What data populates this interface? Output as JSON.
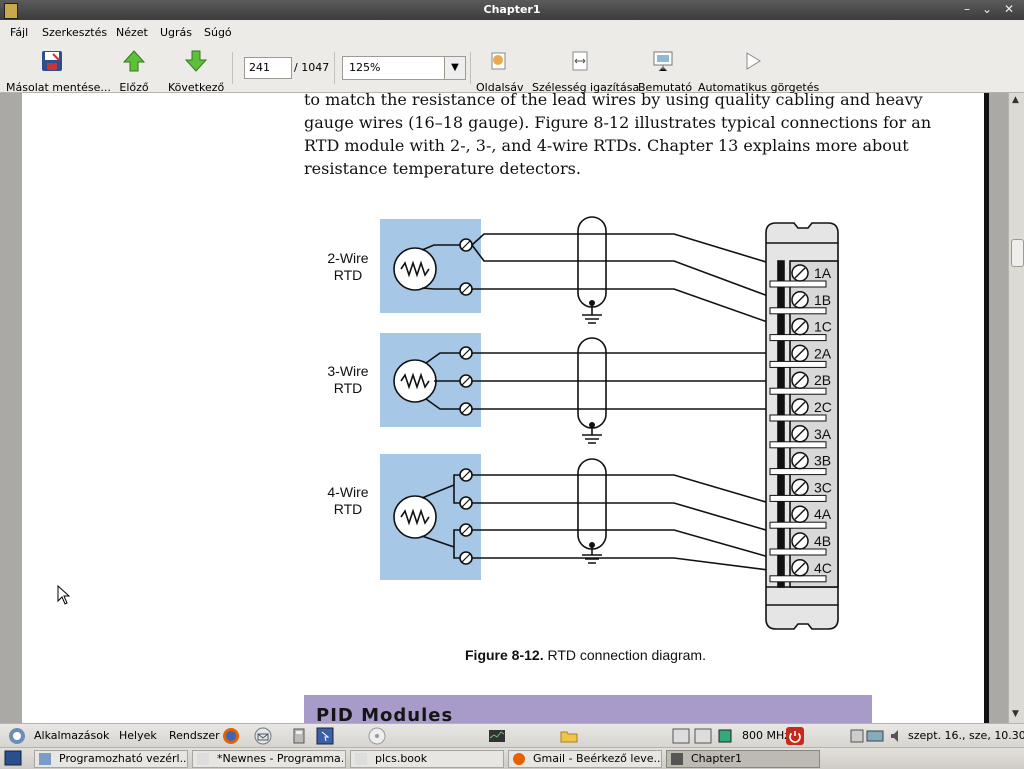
{
  "window": {
    "title": "Chapter1"
  },
  "menu": [
    "Fájl",
    "Szerkesztés",
    "Nézet",
    "Ugrás",
    "Súgó"
  ],
  "toolbar": {
    "save": "Másolat mentése...",
    "prev": "Előző",
    "next": "Következő",
    "page_current": "241",
    "page_total": "/ 1047",
    "zoom": "125%",
    "sidebar": "Oldalsáv",
    "fit_width": "Szélesség igazítása",
    "presentation": "Bemutató",
    "autoscroll": "Automatikus görgetés"
  },
  "document": {
    "lines": [
      "to match the resistance of the lead wires by using quality cabling and heavy",
      "gauge wires (16–18 gauge). Figure 8-12 illustrates typical connections for an",
      "RTD module with 2-, 3-, and 4-wire RTDs. Chapter 13 explains more about",
      "resistance temperature detectors."
    ],
    "figure": {
      "sensor_labels": [
        {
          "line1": "2-Wire",
          "line2": "RTD"
        },
        {
          "line1": "3-Wire",
          "line2": "RTD"
        },
        {
          "line1": "4-Wire",
          "line2": "RTD"
        }
      ],
      "terminals": [
        "1A",
        "1B",
        "1C",
        "2A",
        "2B",
        "2C",
        "3A",
        "3B",
        "3C",
        "4A",
        "4B",
        "4C"
      ]
    },
    "caption_bold": "Figure 8-12.",
    "caption_text": " RTD connection diagram.",
    "next_section": "PID Modules"
  },
  "panel": {
    "apps": "Alkalmazások",
    "places": "Helyek",
    "system": "Rendszer",
    "cpu": "800 MHz",
    "clock": "szept. 16., sze, 10.30"
  },
  "taskbar": [
    {
      "label": "Programozható vezérl...",
      "active": false
    },
    {
      "label": "*Newnes - Programma...",
      "active": false
    },
    {
      "label": "plcs.book",
      "active": false
    },
    {
      "label": "Gmail - Beérkező leve...",
      "active": false
    },
    {
      "label": "Chapter1",
      "active": true
    }
  ],
  "colors": {
    "rtd_box": "#a7c7e7",
    "pid_bar": "#a99bc9"
  }
}
